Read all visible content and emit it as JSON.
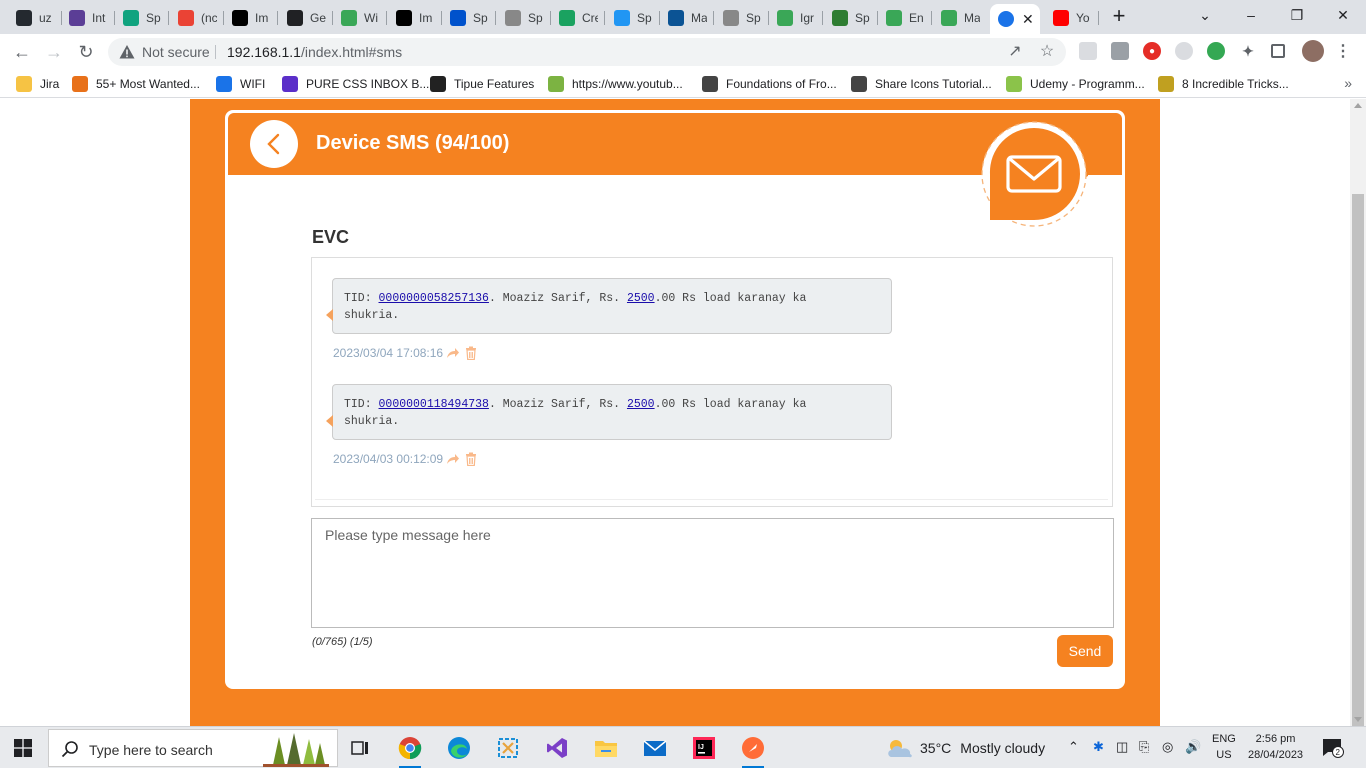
{
  "browser": {
    "tabs": [
      {
        "icon": "github-icon",
        "label": "uz",
        "color": "#24292f"
      },
      {
        "icon": "ai-icon",
        "label": "Int",
        "color": "#5b3e96"
      },
      {
        "icon": "chatgpt-icon",
        "label": "Sp",
        "color": "#10a37f"
      },
      {
        "icon": "gmail-icon",
        "label": "(nc",
        "color": "#ea4335"
      },
      {
        "icon": "medium-icon",
        "label": "Im",
        "color": "#000000"
      },
      {
        "icon": "loom-icon",
        "label": "Ge",
        "color": "#202124"
      },
      {
        "icon": "leaf-icon",
        "label": "Wi",
        "color": "#3aa757"
      },
      {
        "icon": "medium-icon",
        "label": "Im",
        "color": "#000000"
      },
      {
        "icon": "jira-icon",
        "label": "Sp",
        "color": "#0052cc"
      },
      {
        "icon": "docs-icon",
        "label": "Sp",
        "color": "#888888"
      },
      {
        "icon": "vp-icon",
        "label": "Cre",
        "color": "#1aa260"
      },
      {
        "icon": "j-icon",
        "label": "Sp",
        "color": "#2196f3"
      },
      {
        "icon": "mvn-icon",
        "label": "Ma",
        "color": "#0b5394"
      },
      {
        "icon": "docs-icon",
        "label": "Sp",
        "color": "#888888"
      },
      {
        "icon": "leaf-icon",
        "label": "Igr",
        "color": "#3aa757"
      },
      {
        "icon": "java-icon",
        "label": "Sp",
        "color": "#2e7d32"
      },
      {
        "icon": "leaf-icon",
        "label": "En",
        "color": "#3aa757"
      },
      {
        "icon": "leaf-icon",
        "label": "Ma",
        "color": "#3aa757"
      },
      {
        "icon": "globe-icon",
        "label": "",
        "color": "#1a73e8"
      },
      {
        "icon": "youtube-icon",
        "label": "Yo",
        "color": "#ff0000"
      }
    ],
    "not_secure": "Not secure",
    "url_host": "192.168.1.1",
    "url_path": "/index.html#sms",
    "bookmarks": [
      {
        "icon": "folder-icon",
        "label": "Jira",
        "color": "#f6c344"
      },
      {
        "icon": "bookmark-icon",
        "label": "55+ Most Wanted...",
        "color": "#e8711a"
      },
      {
        "icon": "wifi-icon",
        "label": "WIFI",
        "color": "#1a73e8"
      },
      {
        "icon": "w-icon",
        "label": "PURE CSS INBOX B...",
        "color": "#5b2fc9"
      },
      {
        "icon": "t-icon",
        "label": "Tipue Features",
        "color": "#222222"
      },
      {
        "icon": "download-icon",
        "label": "https://www.youtub...",
        "color": "#7cb342"
      },
      {
        "icon": "globe-icon",
        "label": "Foundations of Fro...",
        "color": "#444444"
      },
      {
        "icon": "globe-icon",
        "label": "Share Icons Tutorial...",
        "color": "#444444"
      },
      {
        "icon": "udemy-icon",
        "label": "Udemy - Programm...",
        "color": "#8bc34a"
      },
      {
        "icon": "bookmark-icon",
        "label": "8 Incredible Tricks...",
        "color": "#c0a020"
      }
    ]
  },
  "page": {
    "title": "Device SMS (94/100)",
    "section_title": "EVC",
    "messages": [
      {
        "prefix": "TID: ",
        "tid": "0000000058257136",
        "mid1": ". Moaziz Sarif, Rs. ",
        "amount": "2500",
        "mid2": ".00 Rs  load karanay ka",
        "line2": "shukria.",
        "timestamp": "2023/03/04 17:08:16"
      },
      {
        "prefix": "TID: ",
        "tid": "0000000118494738",
        "mid1": ". Moaziz Sarif, Rs. ",
        "amount": "2500",
        "mid2": ".00 Rs  load karanay ka",
        "line2": "shukria.",
        "timestamp": "2023/04/03 00:12:09"
      }
    ],
    "input_placeholder": "Please type message here",
    "counter": "(0/765) (1/5)",
    "send_label": "Send",
    "accent": "#f58220"
  },
  "taskbar": {
    "search_placeholder": "Type here to search",
    "temperature": "35°C",
    "weather": "Mostly cloudy",
    "lang_1": "ENG",
    "lang_2": "US",
    "time": "2:56 pm",
    "date": "28/04/2023",
    "notifications": "2"
  }
}
